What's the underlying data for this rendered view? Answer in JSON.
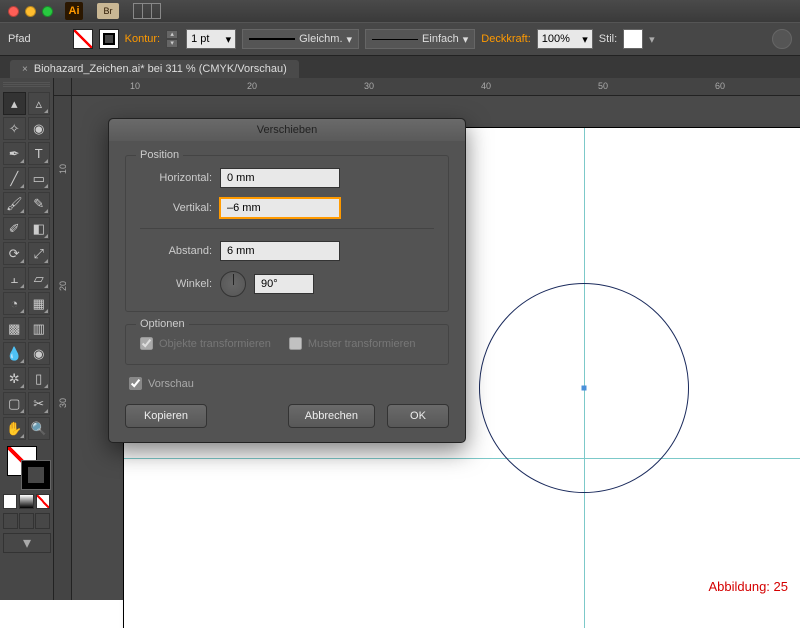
{
  "titlebar": {
    "app_abbrev": "Ai",
    "br": "Br"
  },
  "controlbar": {
    "pfad": "Pfad",
    "kontur_label": "Kontur:",
    "stroke_weight": "1 pt",
    "variable_width": "Gleichm.",
    "brush_def": "Einfach",
    "deckkraft_label": "Deckkraft:",
    "opacity": "100%",
    "stil_label": "Stil:"
  },
  "document": {
    "tab_label": "Biohazard_Zeichen.ai* bei 311 % (CMYK/Vorschau)"
  },
  "ruler_ticks_h": [
    "10",
    "20",
    "30",
    "40",
    "50",
    "60"
  ],
  "ruler_ticks_v": [
    "10",
    "20",
    "30"
  ],
  "dialog": {
    "title": "Verschieben",
    "group_position": "Position",
    "horizontal_label": "Horizontal:",
    "horizontal_value": "0 mm",
    "vertikal_label": "Vertikal:",
    "vertikal_value": "–6 mm",
    "abstand_label": "Abstand:",
    "abstand_value": "6 mm",
    "winkel_label": "Winkel:",
    "winkel_value": "90°",
    "group_optionen": "Optionen",
    "objekte_transformieren": "Objekte transformieren",
    "muster_transformieren": "Muster transformieren",
    "vorschau": "Vorschau",
    "kopieren": "Kopieren",
    "abbrechen": "Abbrechen",
    "ok": "OK"
  },
  "caption": "Abbildung: 25"
}
